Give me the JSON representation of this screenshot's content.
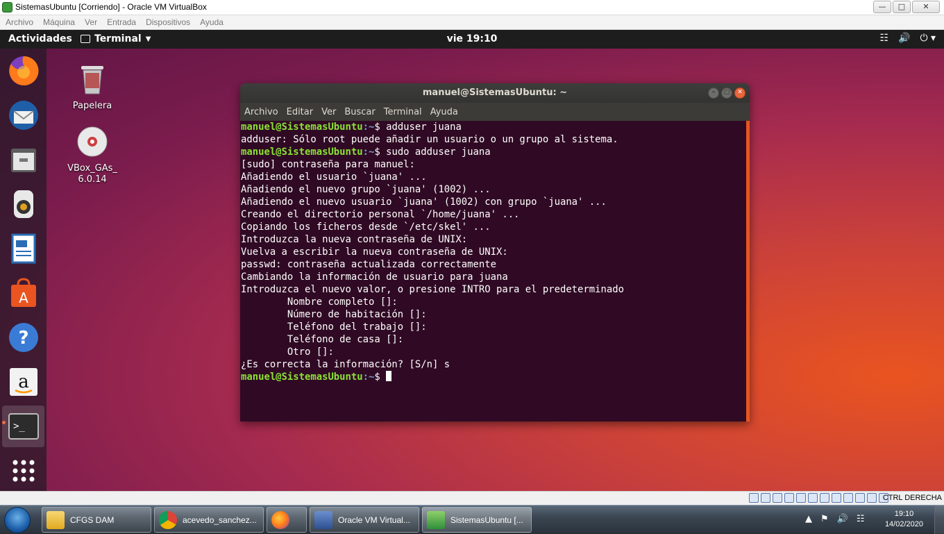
{
  "host_window": {
    "title": "SistemasUbuntu [Corriendo] - Oracle VM VirtualBox",
    "menu": [
      "Archivo",
      "Máquina",
      "Ver",
      "Entrada",
      "Dispositivos",
      "Ayuda"
    ],
    "status_hostkey": "CTRL DERECHA"
  },
  "guest_topbar": {
    "activities": "Actividades",
    "app_menu": "Terminal",
    "clock": "vie 19:10"
  },
  "desktop_icons": [
    {
      "label": "Papelera"
    },
    {
      "label": "VBox_GAs_\n6.0.14"
    }
  ],
  "terminal": {
    "title": "manuel@SistemasUbuntu: ~",
    "menu": [
      "Archivo",
      "Editar",
      "Ver",
      "Buscar",
      "Terminal",
      "Ayuda"
    ],
    "prompt_user": "manuel@SistemasUbuntu",
    "prompt_path": ":~",
    "prompt_symbol": "$ ",
    "lines": [
      {
        "type": "cmd",
        "text": "adduser juana"
      },
      {
        "type": "out",
        "text": "adduser: Sólo root puede añadir un usuario o un grupo al sistema."
      },
      {
        "type": "cmd",
        "text": "sudo adduser juana"
      },
      {
        "type": "out",
        "text": "[sudo] contraseña para manuel:"
      },
      {
        "type": "out",
        "text": "Añadiendo el usuario `juana' ..."
      },
      {
        "type": "out",
        "text": "Añadiendo el nuevo grupo `juana' (1002) ..."
      },
      {
        "type": "out",
        "text": "Añadiendo el nuevo usuario `juana' (1002) con grupo `juana' ..."
      },
      {
        "type": "out",
        "text": "Creando el directorio personal `/home/juana' ..."
      },
      {
        "type": "out",
        "text": "Copiando los ficheros desde `/etc/skel' ..."
      },
      {
        "type": "out",
        "text": "Introduzca la nueva contraseña de UNIX:"
      },
      {
        "type": "out",
        "text": "Vuelva a escribir la nueva contraseña de UNIX:"
      },
      {
        "type": "out",
        "text": "passwd: contraseña actualizada correctamente"
      },
      {
        "type": "out",
        "text": "Cambiando la información de usuario para juana"
      },
      {
        "type": "out",
        "text": "Introduzca el nuevo valor, o presione INTRO para el predeterminado"
      },
      {
        "type": "out",
        "text": "\tNombre completo []:"
      },
      {
        "type": "out",
        "text": "\tNúmero de habitación []:"
      },
      {
        "type": "out",
        "text": "\tTeléfono del trabajo []:"
      },
      {
        "type": "out",
        "text": "\tTeléfono de casa []:"
      },
      {
        "type": "out",
        "text": "\tOtro []:"
      },
      {
        "type": "out",
        "text": "¿Es correcta la información? [S/n] s"
      },
      {
        "type": "cmd",
        "text": ""
      }
    ]
  },
  "taskbar": {
    "buttons": [
      {
        "label": "CFGS DAM",
        "icon": "folder-icon"
      },
      {
        "label": "acevedo_sanchez...",
        "icon": "chrome-icon"
      },
      {
        "label": "",
        "icon": "firefox-icon"
      },
      {
        "label": "Oracle VM Virtual...",
        "icon": "virtualbox-icon"
      },
      {
        "label": "SistemasUbuntu [...",
        "icon": "vm-icon"
      }
    ],
    "time": "19:10",
    "date": "14/02/2020"
  },
  "colors": {
    "ubuntu_orange": "#e95420",
    "terminal_bg": "#300a24",
    "prompt_green": "#8ae234",
    "prompt_blue": "#729fcf"
  }
}
